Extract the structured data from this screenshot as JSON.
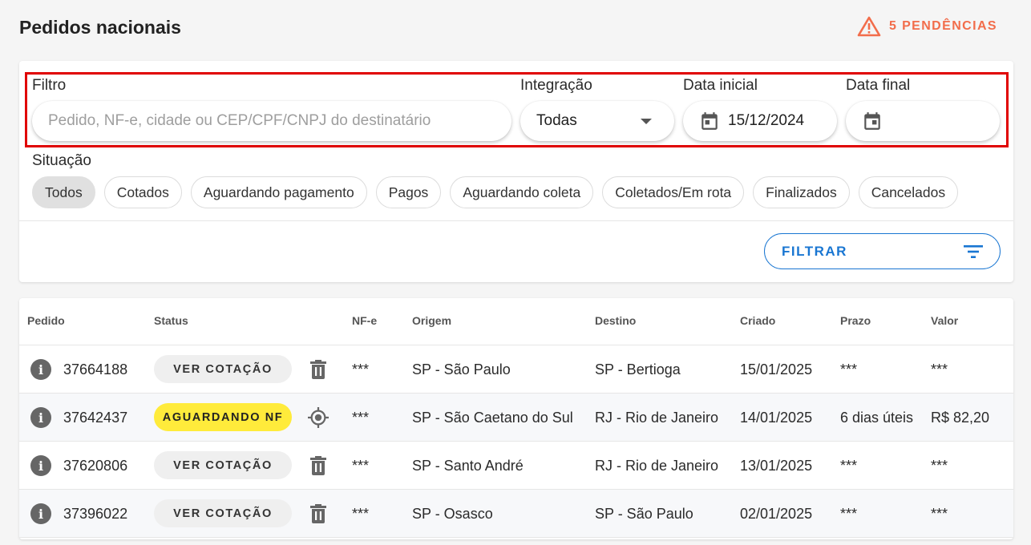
{
  "header": {
    "title": "Pedidos nacionais",
    "pending_label": "5 PENDÊNCIAS"
  },
  "filters": {
    "filtro_label": "Filtro",
    "filtro_placeholder": "Pedido, NF-e, cidade ou CEP/CPF/CNPJ do destinatário",
    "filtro_value": "",
    "integracao_label": "Integração",
    "integracao_value": "Todas",
    "data_inicial_label": "Data inicial",
    "data_inicial_value": "15/12/2024",
    "data_final_label": "Data final",
    "data_final_value": "",
    "situacao_label": "Situação",
    "chips": [
      "Todos",
      "Cotados",
      "Aguardando pagamento",
      "Pagos",
      "Aguardando coleta",
      "Coletados/Em rota",
      "Finalizados",
      "Cancelados"
    ],
    "active_chip": "Todos",
    "filter_button": "FILTRAR"
  },
  "table": {
    "columns": [
      "Pedido",
      "Status",
      "NF-e",
      "Origem",
      "Destino",
      "Criado",
      "Prazo",
      "Valor"
    ],
    "rows": [
      {
        "pedido": "37664188",
        "status": "VER COTAÇÃO",
        "nfe": "***",
        "origem": "SP - São Paulo",
        "destino": "SP - Bertioga",
        "criado": "15/01/2025",
        "prazo": "***",
        "valor": "***"
      },
      {
        "pedido": "37642437",
        "status": "AGUARDANDO NF",
        "nfe": "***",
        "origem": "SP - São Caetano do Sul",
        "destino": "RJ - Rio de Janeiro",
        "criado": "14/01/2025",
        "prazo": "6 dias úteis",
        "valor": "R$ 82,20"
      },
      {
        "pedido": "37620806",
        "status": "VER COTAÇÃO",
        "nfe": "***",
        "origem": "SP - Santo André",
        "destino": "RJ - Rio de Janeiro",
        "criado": "13/01/2025",
        "prazo": "***",
        "valor": "***"
      },
      {
        "pedido": "37396022",
        "status": "VER COTAÇÃO",
        "nfe": "***",
        "origem": "SP - Osasco",
        "destino": "SP - São Paulo",
        "criado": "02/01/2025",
        "prazo": "***",
        "valor": "***"
      }
    ]
  },
  "colors": {
    "warning": "#f26d4b",
    "primary": "#1976d2",
    "highlight_box": "#e00000",
    "status_yellow": "#ffeb3b"
  }
}
